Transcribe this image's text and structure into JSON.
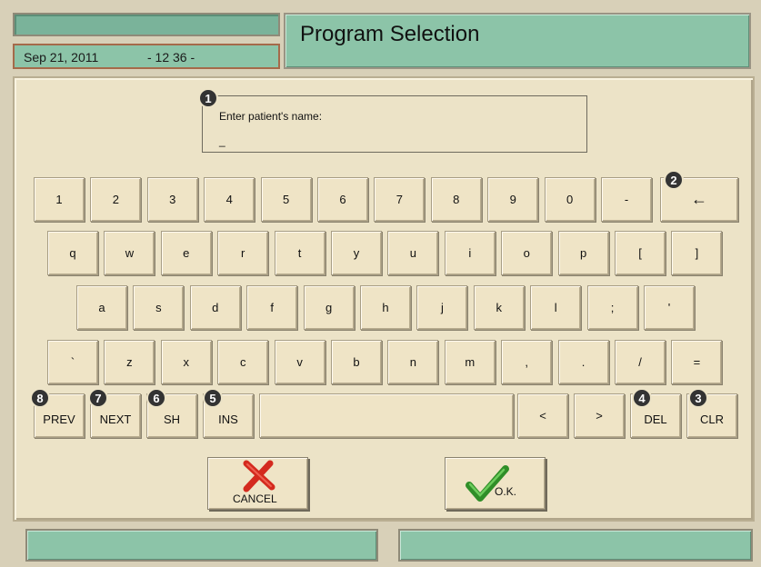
{
  "header": {
    "date": "Sep 21, 2011",
    "time": "- 12 36 -",
    "title": "Program Selection"
  },
  "prompt": {
    "label": "Enter patient's name:",
    "value": "_"
  },
  "keyboard": {
    "row1": [
      "1",
      "2",
      "3",
      "4",
      "5",
      "6",
      "7",
      "8",
      "9",
      "0",
      "-"
    ],
    "backspace": "←",
    "row2": [
      "q",
      "w",
      "e",
      "r",
      "t",
      "y",
      "u",
      "i",
      "o",
      "p",
      "[",
      "]"
    ],
    "row3": [
      "a",
      "s",
      "d",
      "f",
      "g",
      "h",
      "j",
      "k",
      "l",
      ";",
      "'"
    ],
    "row4": [
      "`",
      "z",
      "x",
      "c",
      "v",
      "b",
      "n",
      "m",
      ",",
      ".",
      "/",
      "="
    ],
    "prev": "PREV",
    "next": "NEXT",
    "sh": "SH",
    "ins": "INS",
    "left": "<",
    "right": ">",
    "del": "DEL",
    "clr": "CLR"
  },
  "actions": {
    "cancel": "CANCEL",
    "ok": "O.K."
  },
  "badges": [
    "1",
    "2",
    "3",
    "4",
    "5",
    "6",
    "7",
    "8"
  ],
  "colors": {
    "teal": "#8cc4a8",
    "beige": "#ece3c7",
    "cancel_x": "#d42a1e",
    "ok_check": "#3aa030"
  }
}
